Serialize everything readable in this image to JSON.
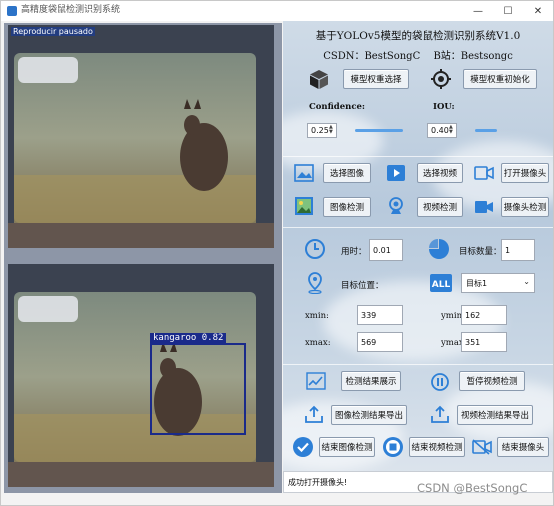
{
  "window": {
    "title": "高精度袋鼠检测识别系统",
    "minimize_glyph": "—",
    "maximize_glyph": "☐",
    "close_glyph": "✕"
  },
  "left_panel": {
    "top_overlay_text": "Reproducir pausado",
    "detection": {
      "label": "kangaroo",
      "score": "0.82",
      "full_label": "kangaroo  0.82"
    }
  },
  "header": {
    "title": "基于YOLOv5模型的袋鼠检测识别系统V1.0",
    "csdn": "CSDN：BestSongC",
    "bilibili": "B站：Bestsongc"
  },
  "model": {
    "select_weights_label": "模型权重选择",
    "init_weights_label": "模型权重初始化",
    "weights_icon": "cube-icon",
    "init_icon": "target-icon"
  },
  "params": {
    "confidence_label": "Confidence:",
    "confidence_value": "0.25",
    "confidence_level": 0.25,
    "iou_label": "IOU:",
    "iou_value": "0.40",
    "iou_level": 0.4
  },
  "source": {
    "select_image": "选择图像",
    "select_video": "选择视频",
    "open_camera": "打开摄像头",
    "image_detect": "图像检测",
    "video_detect": "视频检测",
    "camera_detect": "摄像头检测"
  },
  "results": {
    "time_label": "用时：",
    "time_value": "0.01",
    "count_label": "目标数量：",
    "count_value": "1",
    "position_label": "目标位置：",
    "target_select": "目标1",
    "xmin_label": "xmin:",
    "xmin_value": "339",
    "ymin_label": "ymin:",
    "ymin_value": "162",
    "xmax_label": "xmax:",
    "xmax_value": "569",
    "ymax_label": "ymax:",
    "ymax_value": "351"
  },
  "actions": {
    "show_results": "检测结果展示",
    "pause_video": "暂停视频检测",
    "export_image": "图像检测结果导出",
    "export_video": "视频检测结果导出",
    "end_image": "结束图像检测",
    "end_video": "结束视频检测",
    "end_camera": "结束摄像头"
  },
  "status_text": "成功打开摄像头!",
  "watermark": "CSDN @BestSongC",
  "colors": {
    "accent": "#2d7fd6",
    "detection_box": "#1a2a8a",
    "slider": "#5aa0e6"
  }
}
